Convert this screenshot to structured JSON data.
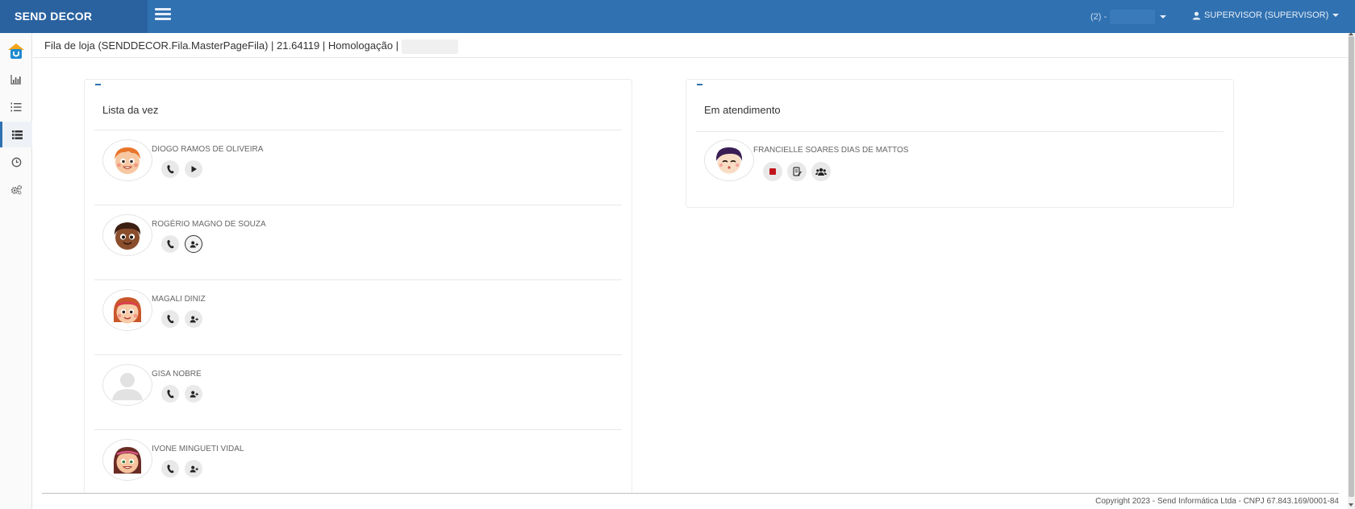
{
  "header": {
    "brand": "SEND DECOR",
    "store_label": "(2) -",
    "user_label": "SUPERVISOR (SUPERVISOR)"
  },
  "sidebar": {
    "items": [
      {
        "icon": "home-logo-icon"
      },
      {
        "icon": "bar-chart-icon"
      },
      {
        "icon": "ordered-list-icon"
      },
      {
        "icon": "list-icon",
        "active": true
      },
      {
        "icon": "clock-icon"
      },
      {
        "icon": "gears-icon"
      }
    ]
  },
  "page": {
    "title": "Fila de loja (SENDDECOR.Fila.MasterPageFila) | 21.64119 | Homologação |"
  },
  "queue": {
    "title": "Lista da vez",
    "people": [
      {
        "name": "DIOGO RAMOS DE OLIVEIRA",
        "actions": [
          "phone-icon",
          "play-icon"
        ]
      },
      {
        "name": "ROGÉRIO MAGNO DE SOUZA",
        "actions": [
          "phone-icon",
          "user-add-icon"
        ]
      },
      {
        "name": "MAGALI DINIZ",
        "actions": [
          "phone-icon",
          "user-add-icon"
        ]
      },
      {
        "name": "GISA NOBRE",
        "actions": [
          "phone-icon",
          "user-add-icon"
        ]
      },
      {
        "name": "IVONE MINGUETI VIDAL",
        "actions": [
          "phone-icon",
          "user-add-icon"
        ]
      }
    ]
  },
  "service": {
    "title": "Em atendimento",
    "people": [
      {
        "name": "FRANCIELLE SOARES DIAS DE MATTOS",
        "actions": [
          "stop-icon",
          "edit-note-icon",
          "group-icon"
        ]
      }
    ]
  },
  "footer": {
    "copyright": "Copyright 2023 - Send Informática Ltda - CNPJ 67.843.169/0001-84"
  },
  "colors": {
    "primary": "#3071b1",
    "brand_bg": "#2a62a0",
    "stop": "#c0161b"
  }
}
